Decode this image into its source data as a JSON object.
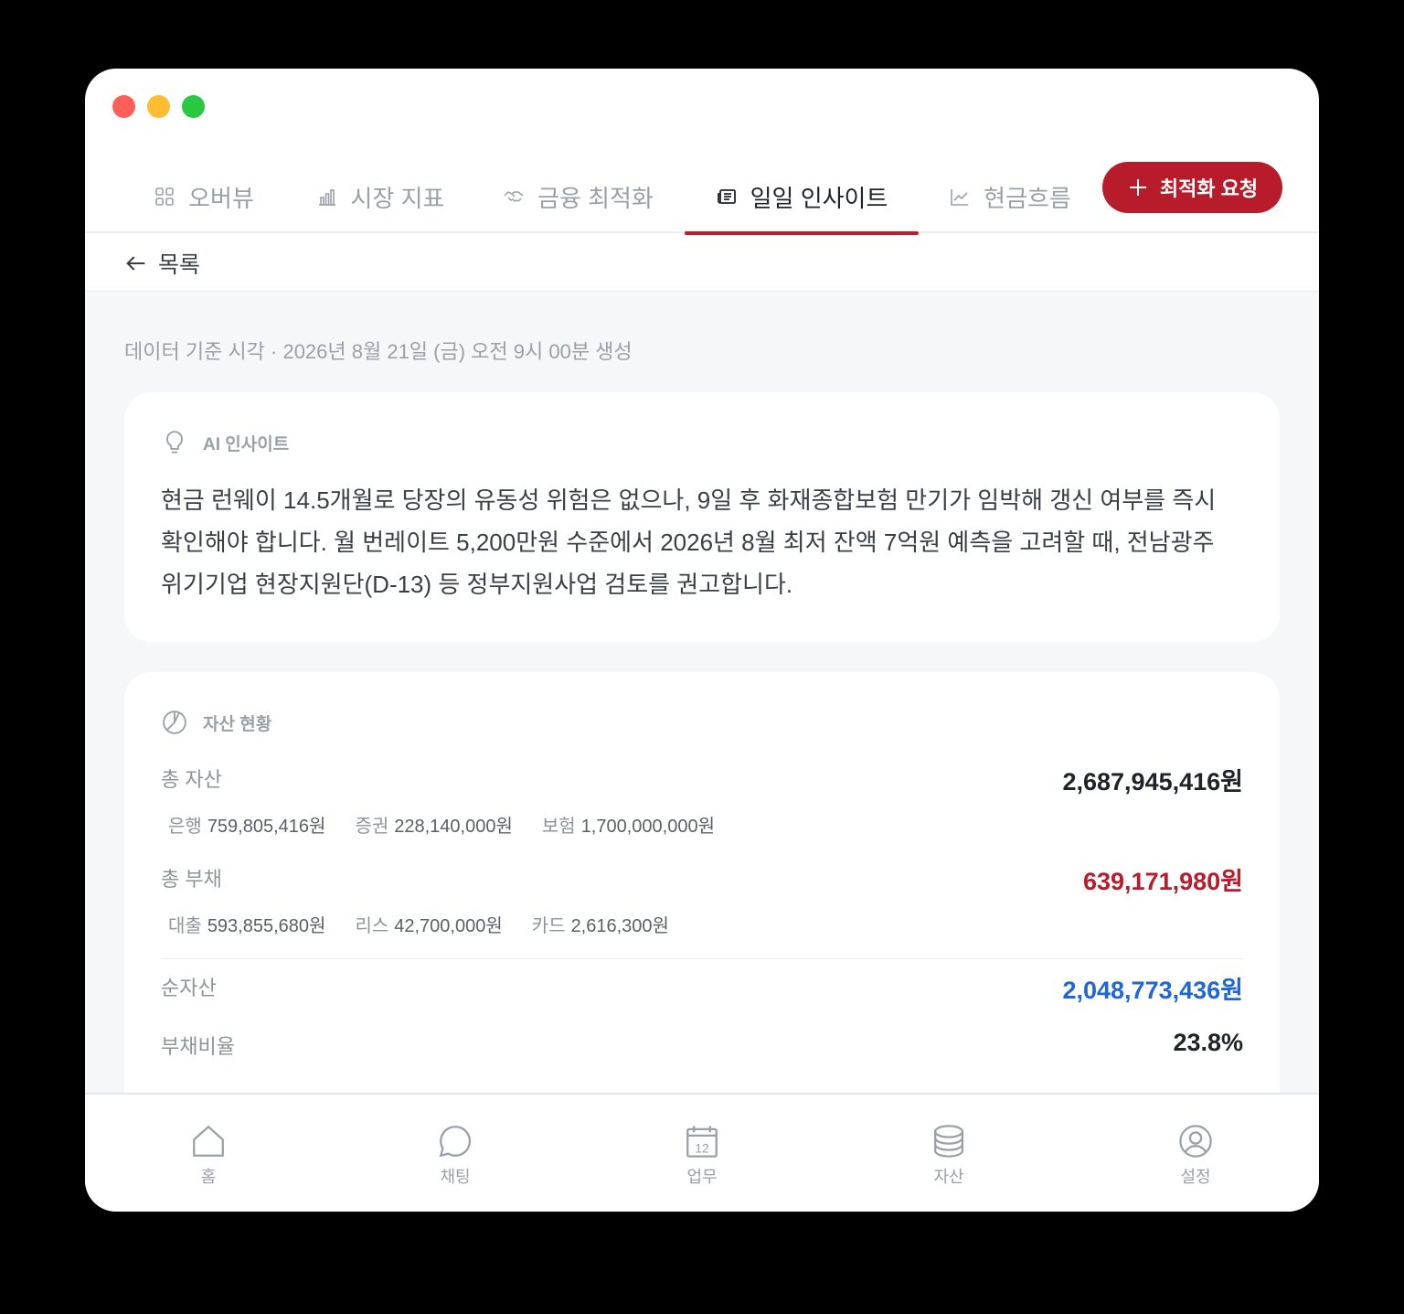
{
  "tabs": [
    {
      "label": "오버뷰",
      "icon": "grid-icon"
    },
    {
      "label": "시장 지표",
      "icon": "bar-chart-icon"
    },
    {
      "label": "금융 최적화",
      "icon": "handshake-icon"
    },
    {
      "label": "일일 인사이트",
      "icon": "newspaper-icon",
      "active": true
    },
    {
      "label": "현금흐름",
      "icon": "trend-line-icon"
    }
  ],
  "cta": {
    "label": "최적화 요청",
    "icon": "plus-icon",
    "color": "#b81c2b"
  },
  "back": {
    "label": "목록",
    "icon": "arrow-left-icon"
  },
  "timestamp": "데이터 기준 시각 · 2026년 8월 21일 (금) 오전 9시 00분 생성",
  "insight": {
    "title": "AI 인사이트",
    "icon": "lightbulb-icon",
    "lines": [
      "현금 런웨이 14.5개월로 당장의 유동성 위험은 없으나, 9일 후 화재종합보험 만기가 임박해 갱신 여부를 즉시",
      "확인해야 합니다. 월 번레이트 5,200만원 수준에서 2026년 8월 최저 잔액 7억원 예측을 고려할 때, 전남광주",
      "위기기업 현장지원단(D-13) 등 정부지원사업 검토를 권고합니다."
    ]
  },
  "assets": {
    "title": "자산 현황",
    "icon": "pie-chart-icon",
    "total_assets": {
      "label": "총 자산",
      "value": "2,687,945,416원"
    },
    "asset_breakdown": [
      {
        "label": "은행",
        "value": "759,805,416원"
      },
      {
        "label": "증권",
        "value": "228,140,000원"
      },
      {
        "label": "보험",
        "value": "1,700,000,000원"
      }
    ],
    "total_liabilities": {
      "label": "총 부채",
      "value": "639,171,980원",
      "color": "#b81c2b"
    },
    "liability_breakdown": [
      {
        "label": "대출",
        "value": "593,855,680원"
      },
      {
        "label": "리스",
        "value": "42,700,000원"
      },
      {
        "label": "카드",
        "value": "2,616,300원"
      }
    ],
    "net_assets": {
      "label": "순자산",
      "value": "2,048,773,436원",
      "color": "#1f66d6"
    },
    "debt_ratio": {
      "label": "부채비율",
      "value": "23.8%"
    }
  },
  "bottom_nav": [
    {
      "label": "홈",
      "icon": "home-icon"
    },
    {
      "label": "채팅",
      "icon": "chat-bubble-icon"
    },
    {
      "label": "업무",
      "icon": "calendar-icon",
      "badge": "12"
    },
    {
      "label": "자산",
      "icon": "database-icon"
    },
    {
      "label": "설정",
      "icon": "user-circle-icon"
    }
  ]
}
